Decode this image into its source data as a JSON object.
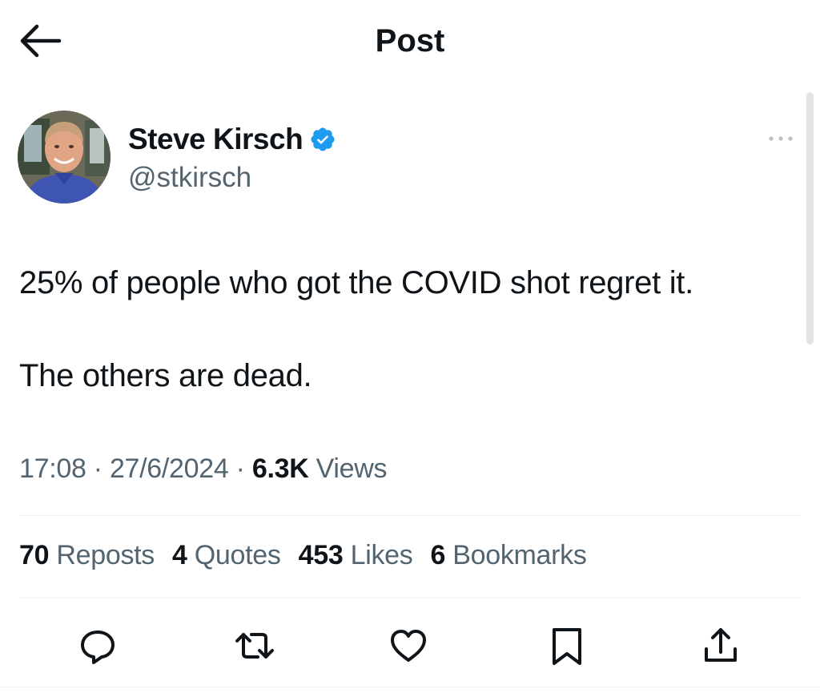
{
  "header": {
    "title": "Post",
    "back_icon": "arrow-left-icon"
  },
  "author": {
    "display_name": "Steve Kirsch",
    "handle": "@stkirsch",
    "verified": true,
    "verified_color": "#1d9bf0"
  },
  "post": {
    "lines": [
      "25% of people who got the COVID shot regret it.",
      "The others are dead."
    ],
    "time": "17:08",
    "date": "27/6/2024",
    "separator": "·",
    "views_count": "6.3K",
    "views_label": "Views"
  },
  "stats": [
    {
      "count": "70",
      "label": "Reposts"
    },
    {
      "count": "4",
      "label": "Quotes"
    },
    {
      "count": "453",
      "label": "Likes"
    },
    {
      "count": "6",
      "label": "Bookmarks"
    }
  ],
  "actions": [
    "reply-icon",
    "repost-icon",
    "like-icon",
    "bookmark-icon",
    "share-icon"
  ],
  "colors": {
    "text_primary": "#0f1419",
    "text_secondary": "#536471",
    "divider": "#eff3f4"
  }
}
